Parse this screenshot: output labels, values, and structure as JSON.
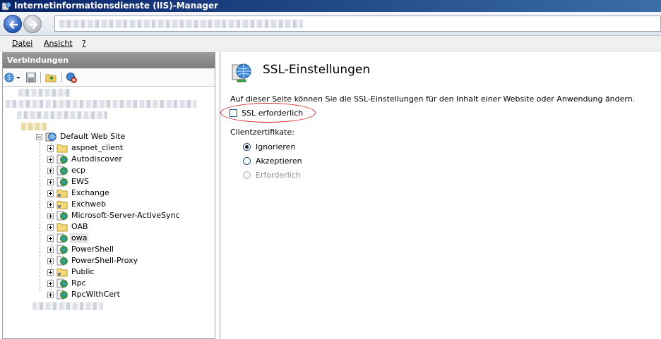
{
  "window": {
    "title": "Internetinformationsdienste (IIS)-Manager"
  },
  "menu": {
    "items": [
      "Datei",
      "Ansicht",
      "?"
    ]
  },
  "connections": {
    "header": "Verbindungen",
    "site": "Default Web Site",
    "children": [
      {
        "label": "aspnet_client",
        "icon": "folder-icon"
      },
      {
        "label": "Autodiscover",
        "icon": "web-app-icon"
      },
      {
        "label": "ecp",
        "icon": "web-app-icon"
      },
      {
        "label": "EWS",
        "icon": "web-app-icon"
      },
      {
        "label": "Exchange",
        "icon": "virtual-dir-icon"
      },
      {
        "label": "Exchweb",
        "icon": "virtual-dir-icon"
      },
      {
        "label": "Microsoft-Server-ActiveSync",
        "icon": "web-app-icon"
      },
      {
        "label": "OAB",
        "icon": "folder-icon"
      },
      {
        "label": "owa",
        "icon": "web-app-icon",
        "selected": true
      },
      {
        "label": "PowerShell",
        "icon": "web-app-icon"
      },
      {
        "label": "PowerShell-Proxy",
        "icon": "web-app-icon"
      },
      {
        "label": "Public",
        "icon": "virtual-dir-icon"
      },
      {
        "label": "Rpc",
        "icon": "web-app-icon"
      },
      {
        "label": "RpcWithCert",
        "icon": "web-app-icon"
      }
    ]
  },
  "ssl": {
    "title": "SSL-Einstellungen",
    "description": "Auf dieser Seite können Sie die SSL-Einstellungen für den Inhalt einer Website oder Anwendung ändern.",
    "require_ssl_label": "SSL erforderlich",
    "require_ssl_checked": false,
    "client_cert_label": "Clientzertifikate:",
    "options": [
      {
        "label": "Ignorieren",
        "checked": true,
        "enabled": true
      },
      {
        "label": "Akzeptieren",
        "checked": false,
        "enabled": true
      },
      {
        "label": "Erforderlich",
        "checked": false,
        "enabled": false
      }
    ]
  },
  "colors": {
    "titlebar": "#0a246a",
    "highlight": "#d42a2a",
    "pane_header": "#8a8a8a"
  }
}
